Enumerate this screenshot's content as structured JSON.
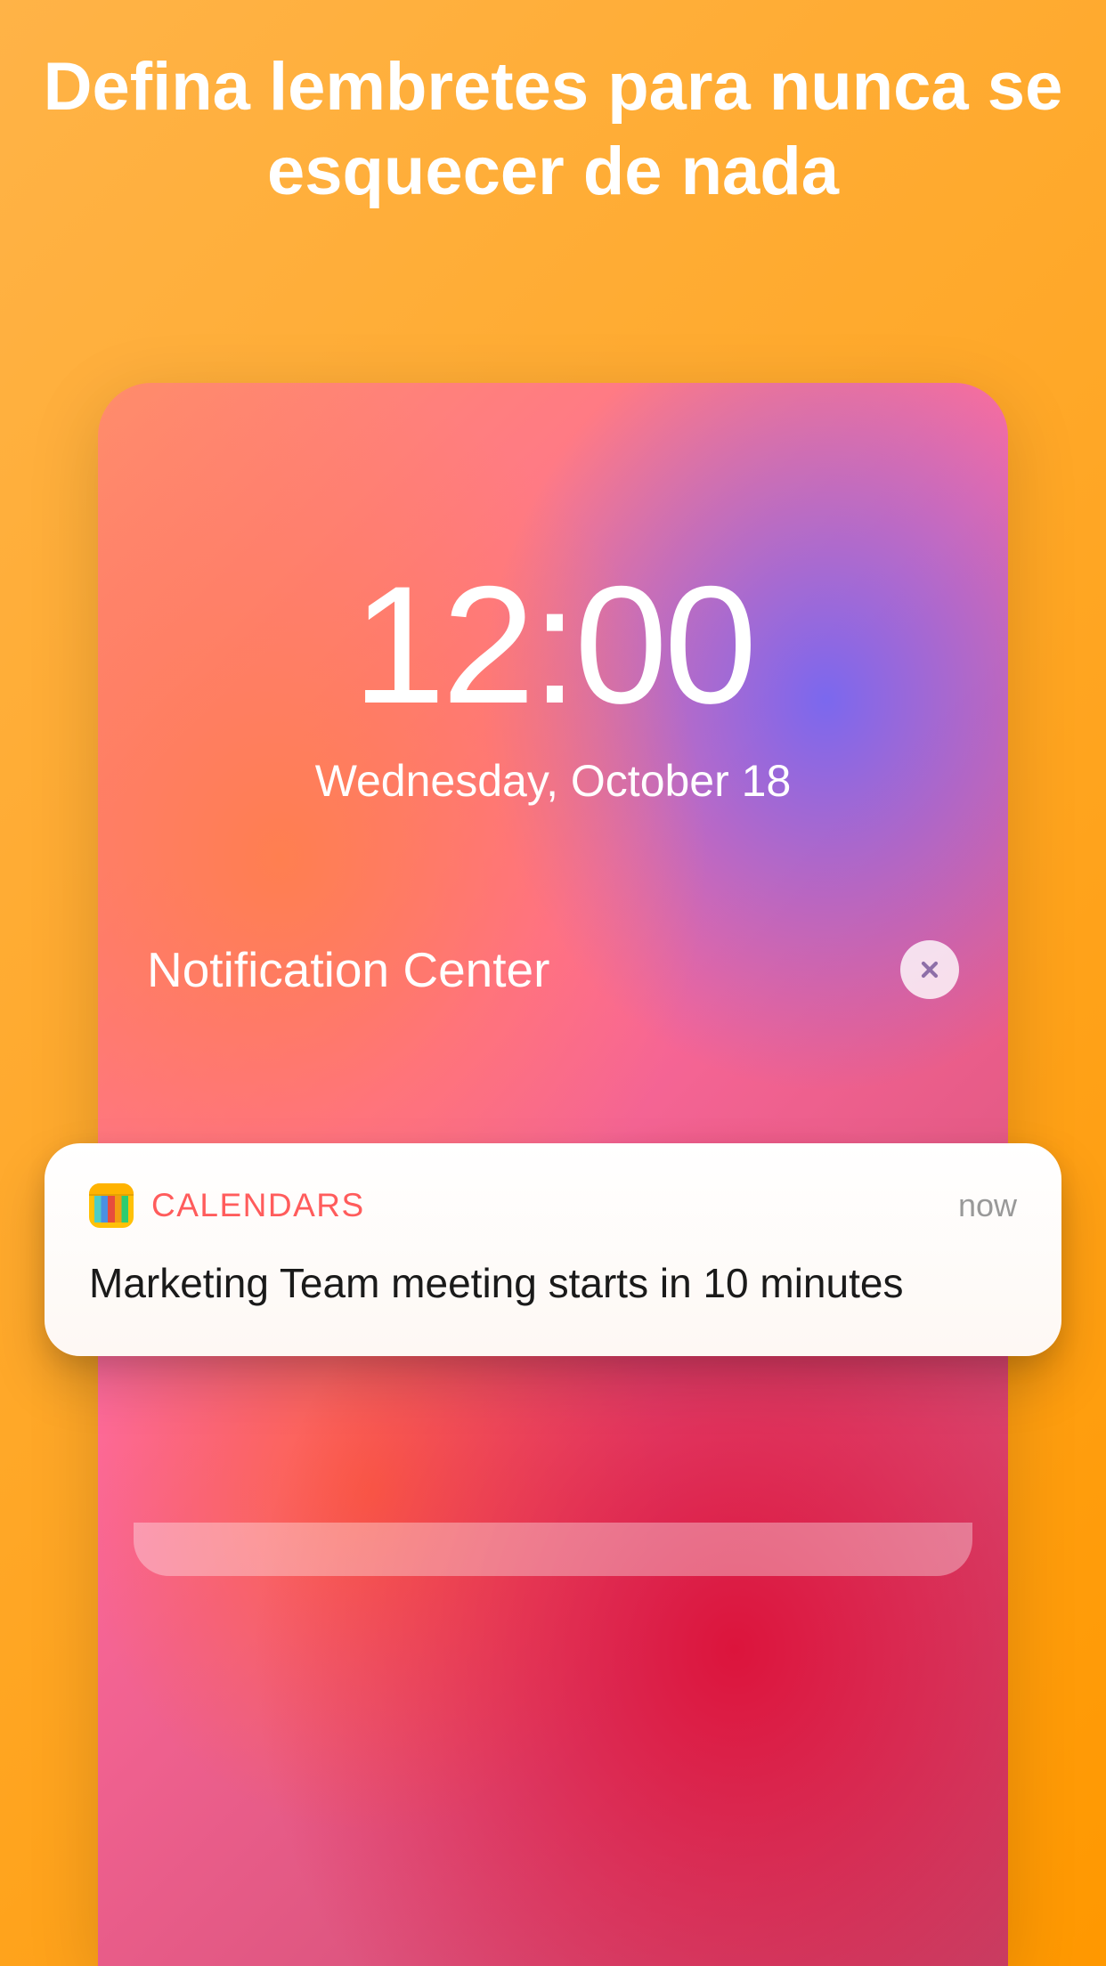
{
  "headline": "Defina lembretes para nunca se esquecer de nada",
  "lock_screen": {
    "time": "12:00",
    "date": "Wednesday, October 18",
    "notif_center_label": "Notification Center"
  },
  "notification": {
    "app_name": "CALENDARS",
    "time": "now",
    "body": "Marketing Team meeting starts in 10 minutes"
  }
}
